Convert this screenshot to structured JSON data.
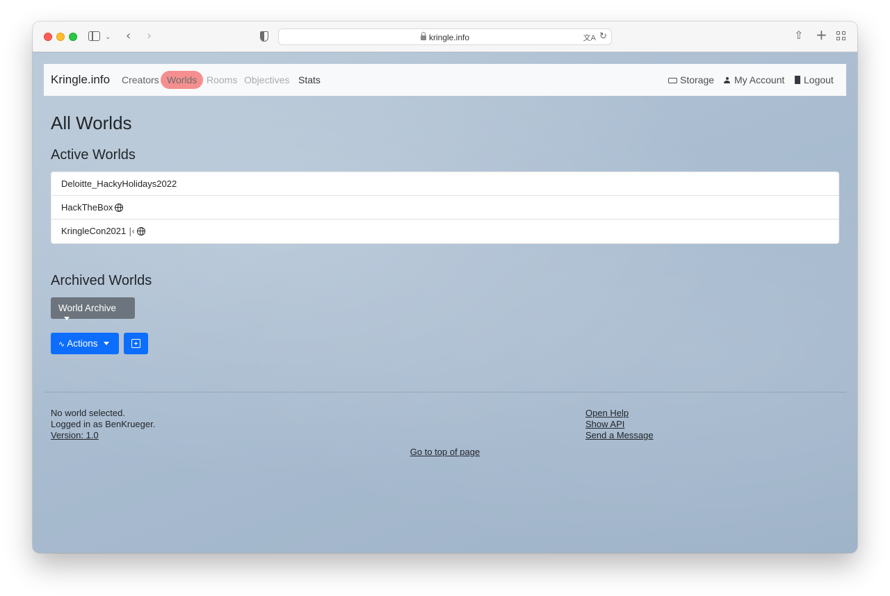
{
  "browser": {
    "url": "kringle.info"
  },
  "navbar": {
    "brand": "Kringle.info",
    "items": [
      {
        "label": "Creators"
      },
      {
        "label": "Worlds"
      },
      {
        "label": "Rooms"
      },
      {
        "label": "Objectives"
      },
      {
        "label": "Stats"
      }
    ],
    "right": {
      "storage": "Storage",
      "account": "My Account",
      "logout": "Logout"
    }
  },
  "main": {
    "title": "All Worlds",
    "active_heading": "Active Worlds",
    "active_worlds": [
      {
        "name": "Deloitte_HackyHolidays2022"
      },
      {
        "name": "HackTheBox"
      },
      {
        "name": "KringleCon2021"
      }
    ],
    "archived_heading": "Archived Worlds",
    "archive_button": "World Archive",
    "actions_button": "Actions"
  },
  "footer": {
    "status": "No world selected.",
    "logged_in": "Logged in as BenKrueger.",
    "version": "Version: 1.0",
    "open_help": "Open Help",
    "show_api": "Show API",
    "send_message": "Send a Message",
    "to_top": "Go to top of page"
  },
  "colors": {
    "active_nav_highlight": "#f58f8f",
    "primary": "#0d6efd",
    "secondary": "#6c757d"
  }
}
